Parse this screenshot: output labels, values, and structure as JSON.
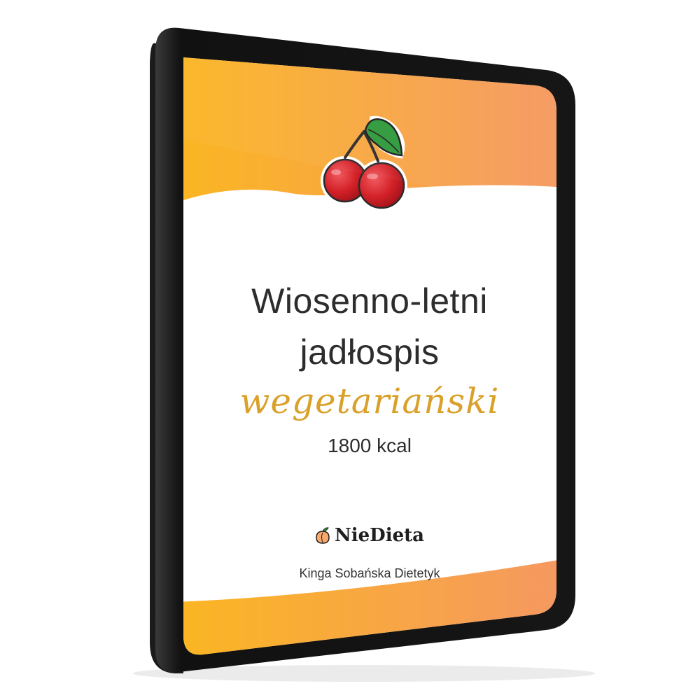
{
  "cover": {
    "title_line_1": "Wiosenno-letni",
    "title_line_2": "jadłospis",
    "title_script": "wegetariański",
    "calories": "1800 kcal",
    "brand_name": "NieDieta",
    "author": "Kinga Sobańska Dietetyk"
  },
  "colors": {
    "gradient_start": "#fbb622",
    "gradient_end": "#f59862",
    "script_accent": "#d9a12a",
    "cherry_red": "#d32027",
    "leaf_green": "#2f9a3c",
    "device_frame": "#141414"
  },
  "icons": {
    "cherry": "cherry-icon",
    "brand_logo": "peach-icon"
  }
}
